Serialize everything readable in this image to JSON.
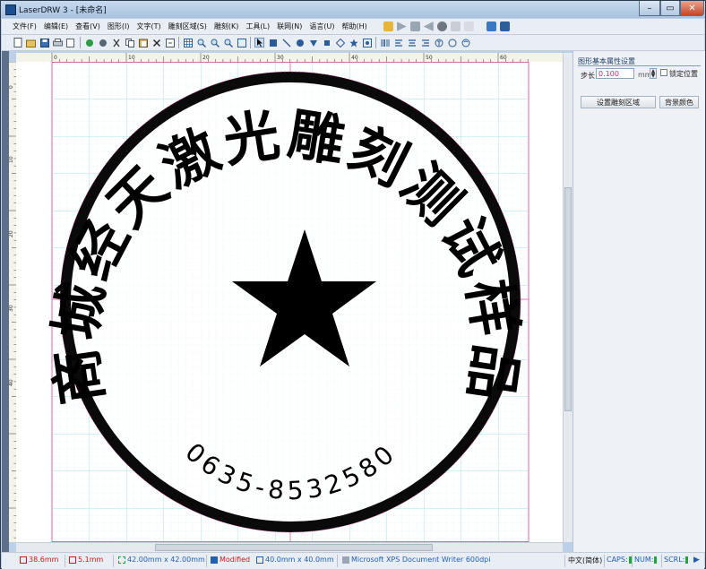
{
  "window": {
    "title": "LaserDRW 3 - [未命名]",
    "controls": {
      "minimize": "–",
      "restore": "▭",
      "close": "✕"
    }
  },
  "menu": {
    "items": [
      "文件(F)",
      "编辑(E)",
      "查看(V)",
      "图形(I)",
      "文字(T)",
      "雕刻区域(S)",
      "雕刻(K)",
      "工具(L)",
      "联网(N)",
      "语言(U)",
      "帮助(H)"
    ]
  },
  "ruler": {
    "h_labels": [
      "0",
      "10",
      "20",
      "30",
      "40",
      "50",
      "60"
    ],
    "v_labels": [
      "0",
      "10",
      "20",
      "30",
      "40"
    ]
  },
  "stamp": {
    "arc_text": "商城经天激光雕刻测试样品",
    "phone": "0635-8532580",
    "center_symbol": "★"
  },
  "panel": {
    "title": "图形基本属性设置",
    "step_label": "步长",
    "step_value": "0.100",
    "step_unit": "mm",
    "lock_label": "锁定位置",
    "btn_region": "设置雕刻区域",
    "btn_bg": "背景颜色"
  },
  "status": {
    "x_pos": "38.6mm",
    "y_pos": "5.1mm",
    "object_size": "42.00mm x 42.00mm",
    "modified": "Modified",
    "page_size": "40.0mm x 40.0mm",
    "printer": "Microsoft XPS Document Writer 600dpi",
    "ime": "中文(简体)",
    "caps": "CAPS:",
    "num": "NUM:",
    "scrl": "SCRL:"
  },
  "colors": {
    "accent_blue": "#1f5fb4",
    "status_red": "#d01818",
    "indicator_green": "#1fa63a",
    "grid_cyan": "#a9e8ef",
    "guide_magenta": "#e0479a"
  }
}
